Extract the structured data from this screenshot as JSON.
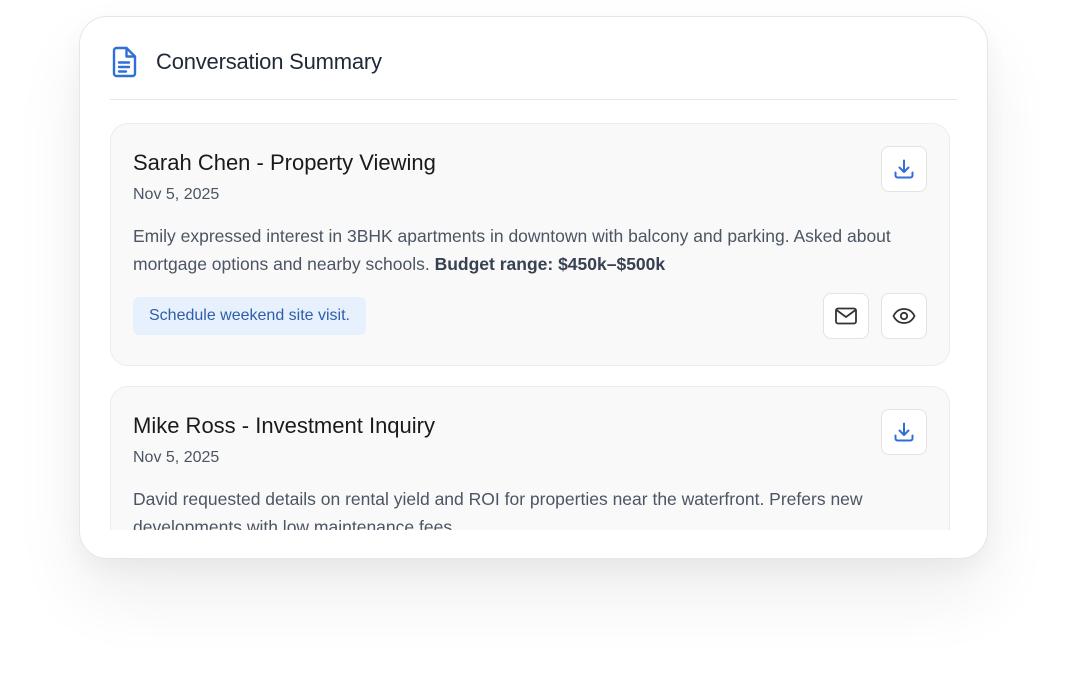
{
  "header": {
    "icon": "document-icon",
    "title": "Conversation Summary"
  },
  "colors": {
    "accent": "#2f6fd6",
    "tag_bg": "#e7f0fd",
    "tag_text": "#2e5ea8",
    "card_bg": "#f9f9f9"
  },
  "conversations": [
    {
      "title": "Sarah Chen - Property Viewing",
      "date": "Nov 5, 2025",
      "summary": "Emily expressed interest in 3BHK apartments in downtown with balcony and parking. Asked about mortgage options and nearby schools.",
      "highlight": "Budget range: $450k–$500k",
      "action_tag": "Schedule weekend site visit.",
      "icons": [
        "download-icon",
        "mail-icon",
        "eye-icon"
      ]
    },
    {
      "title": "Mike Ross - Investment Inquiry",
      "date": "Nov 5, 2025",
      "summary": "David requested details on rental yield and ROI for properties near the waterfront. Prefers new developments with low maintenance fees.",
      "icons": [
        "download-icon"
      ]
    }
  ]
}
